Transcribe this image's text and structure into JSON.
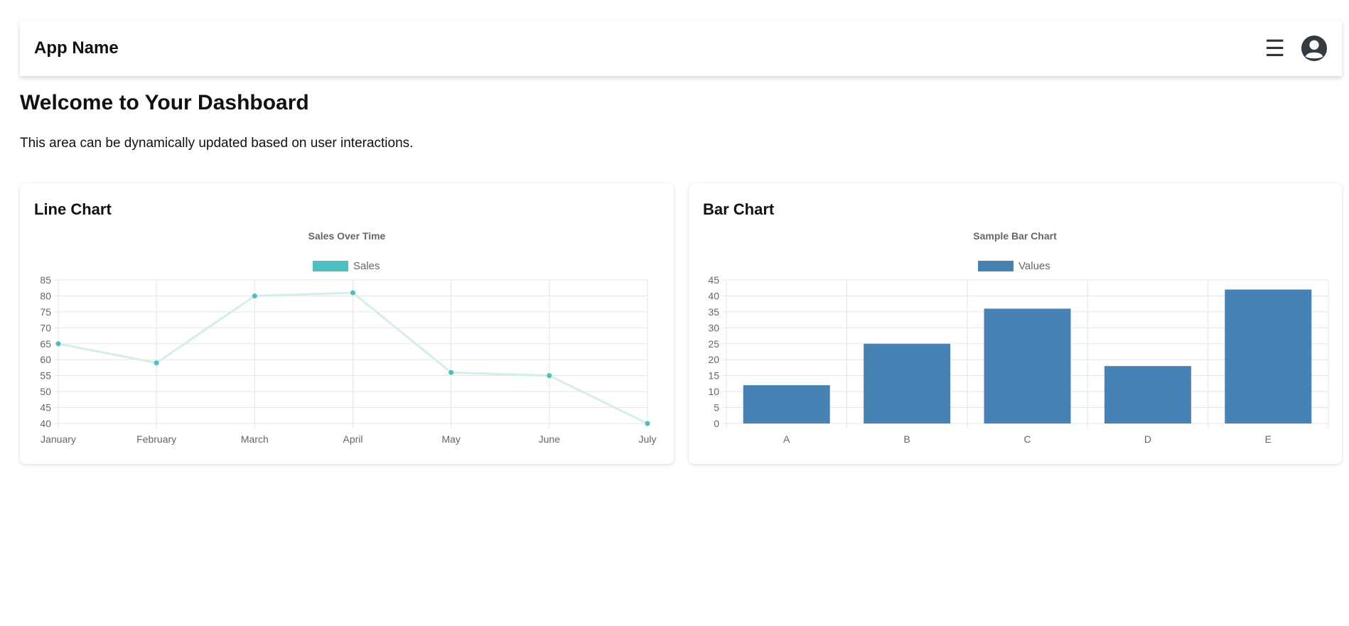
{
  "navbar": {
    "brand": "App Name",
    "menu_icon": "hamburger-menu-icon",
    "profile_icon": "user-avatar-icon"
  },
  "main": {
    "title": "Welcome to Your Dashboard",
    "description": "This area can be dynamically updated based on user interactions."
  },
  "cards": {
    "line": {
      "title": "Line Chart"
    },
    "bar": {
      "title": "Bar Chart"
    }
  },
  "colors": {
    "line_point": "#4bc0c0",
    "line_stroke": "#d3eeef",
    "bar_fill": "#4682b4",
    "grid": "#e5e5e5",
    "text_muted": "#666666"
  },
  "chart_data": [
    {
      "type": "line",
      "title": "Sales Over Time",
      "categories": [
        "January",
        "February",
        "March",
        "April",
        "May",
        "June",
        "July"
      ],
      "series": [
        {
          "name": "Sales",
          "values": [
            65,
            59,
            80,
            81,
            56,
            55,
            40
          ]
        }
      ],
      "ylim": [
        40,
        85
      ],
      "yticks": [
        40,
        45,
        50,
        55,
        60,
        65,
        70,
        75,
        80,
        85
      ],
      "grid": true,
      "legend": "top"
    },
    {
      "type": "bar",
      "title": "Sample Bar Chart",
      "categories": [
        "A",
        "B",
        "C",
        "D",
        "E"
      ],
      "series": [
        {
          "name": "Values",
          "values": [
            12,
            25,
            36,
            18,
            42
          ]
        }
      ],
      "ylim": [
        0,
        45
      ],
      "yticks": [
        0,
        5,
        10,
        15,
        20,
        25,
        30,
        35,
        40,
        45
      ],
      "grid": true,
      "legend": "top"
    }
  ]
}
